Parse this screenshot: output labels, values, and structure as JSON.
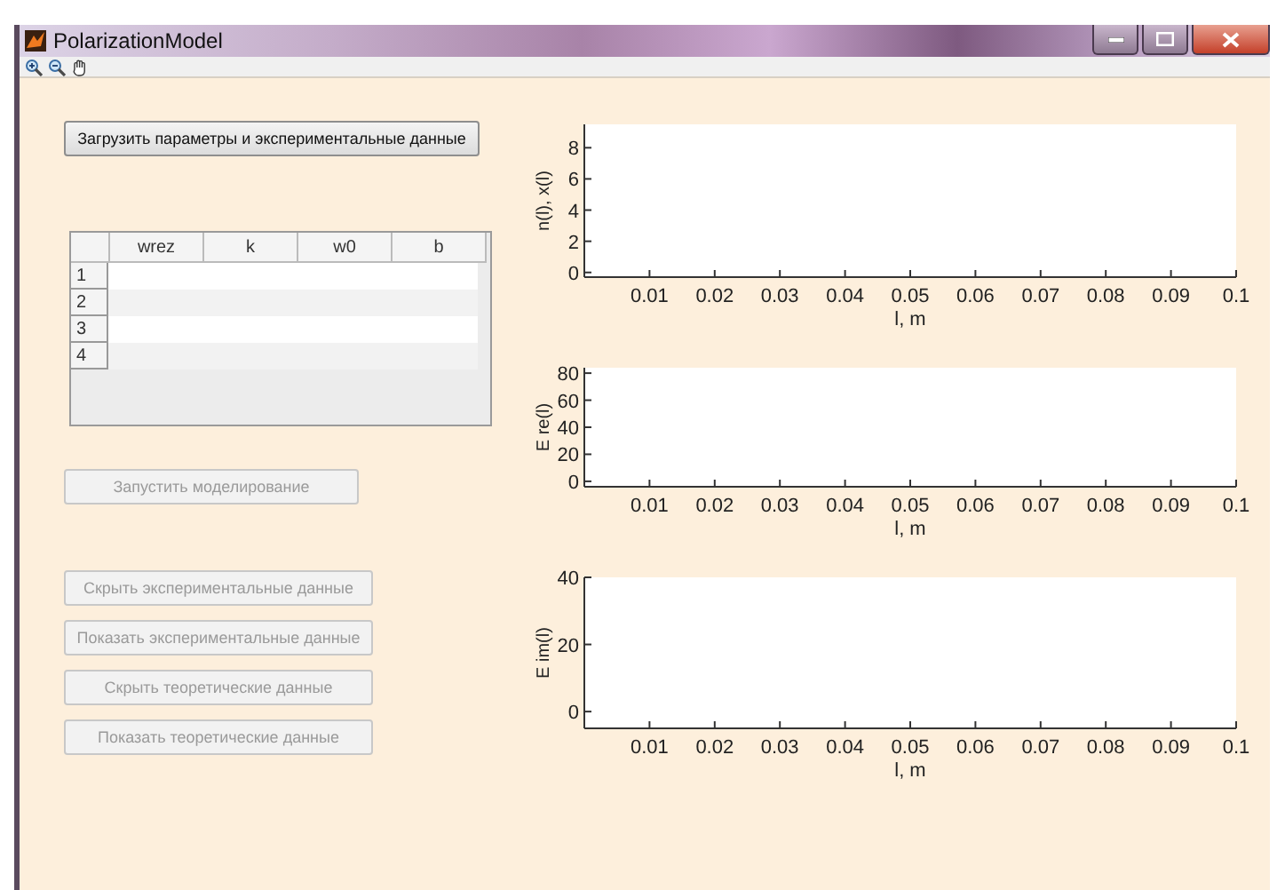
{
  "window": {
    "title": "PolarizationModel"
  },
  "toolbar": {
    "tools": [
      {
        "kind": "zoom-in"
      },
      {
        "kind": "zoom-out"
      },
      {
        "kind": "pan"
      }
    ]
  },
  "load_button": {
    "label": "Загрузить параметры и экспериментальные данные",
    "disabled": false
  },
  "table": {
    "columns": [
      "wrez",
      "k",
      "w0",
      "b"
    ],
    "rows": [
      "1",
      "2",
      "3",
      "4"
    ]
  },
  "run_button": {
    "label": "Запустить моделирование",
    "disabled": true
  },
  "buttons": [
    {
      "label": "Скрыть экспериментальные данные",
      "disabled": true
    },
    {
      "label": "Показать экспериментальные данные",
      "disabled": true
    },
    {
      "label": "Скрыть теоретические данные",
      "disabled": true
    },
    {
      "label": "Показать теоретические данные",
      "disabled": true
    }
  ],
  "plots": [
    {
      "chart_data": {
        "type": "line",
        "xlabel": "l, m",
        "ylabel": "n(l), x(l)",
        "xlim": [
          0,
          0.1
        ],
        "ylim": [
          -0.3,
          9.5
        ],
        "xticks": [
          0.01,
          0.02,
          0.03,
          0.04,
          0.05,
          0.06,
          0.07,
          0.08,
          0.09,
          0.1
        ],
        "yticks": [
          0,
          2,
          4,
          6,
          8
        ]
      }
    },
    {
      "chart_data": {
        "type": "line",
        "xlabel": "l, m",
        "ylabel": "E re(l)",
        "xlim": [
          0,
          0.1
        ],
        "ylim": [
          -4,
          84
        ],
        "xticks": [
          0.01,
          0.02,
          0.03,
          0.04,
          0.05,
          0.06,
          0.07,
          0.08,
          0.09,
          0.1
        ],
        "yticks": [
          0,
          20,
          40,
          60,
          80
        ]
      }
    },
    {
      "chart_data": {
        "type": "line",
        "xlabel": "l, m",
        "ylabel": "E im(l)",
        "xlim": [
          0,
          0.1
        ],
        "ylim": [
          -5,
          40
        ],
        "xticks": [
          0.01,
          0.02,
          0.03,
          0.04,
          0.05,
          0.06,
          0.07,
          0.08,
          0.09,
          0.1
        ],
        "yticks": [
          0,
          20,
          40
        ]
      }
    }
  ]
}
